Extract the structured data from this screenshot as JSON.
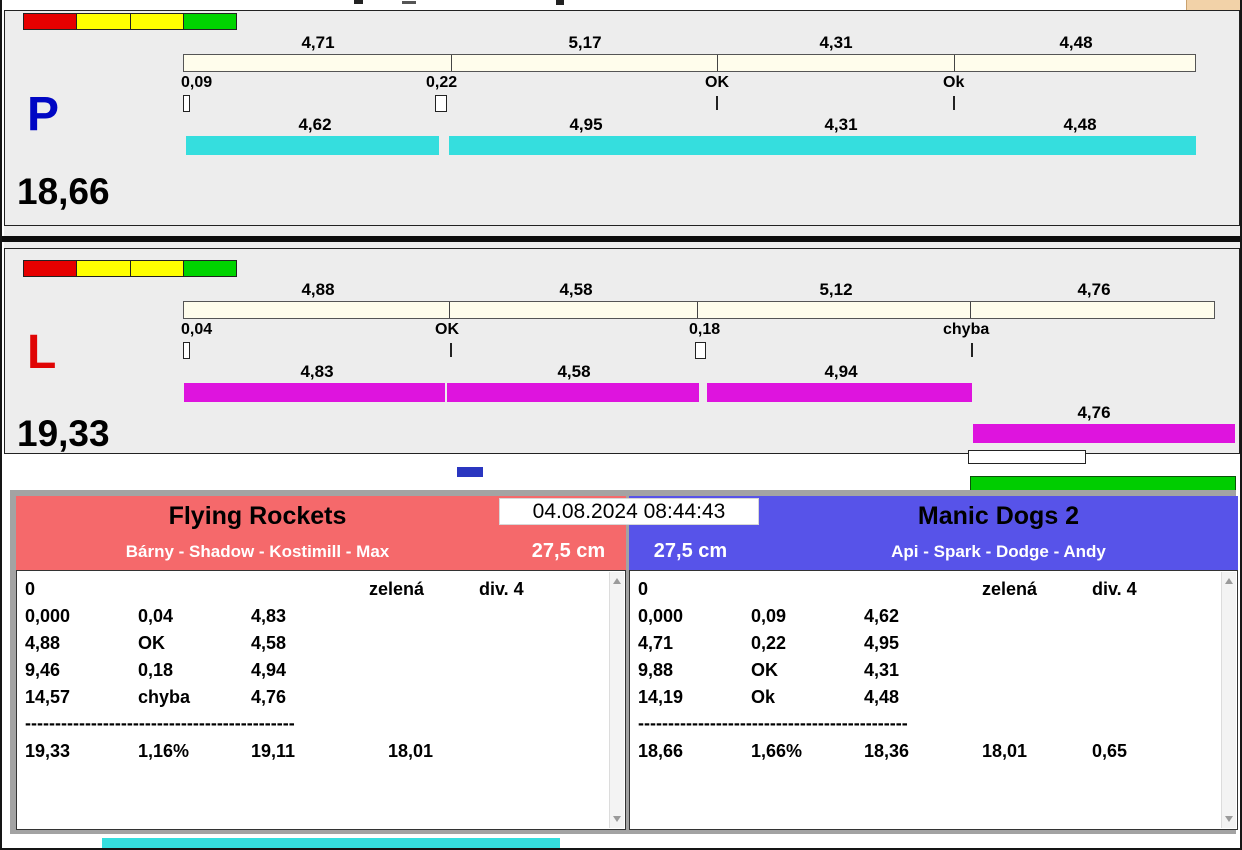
{
  "window": {
    "datetime": "04.08.2024 08:44:43"
  },
  "lanes": {
    "p": {
      "letter": "P",
      "total": "18,66",
      "splits_top": [
        "4,71",
        "5,17",
        "4,31",
        "4,48"
      ],
      "change_labels": [
        "0,09",
        "0,22",
        "OK",
        "Ok"
      ],
      "splits_bottom": [
        "4,62",
        "4,95",
        "4,31",
        "4,48"
      ]
    },
    "l": {
      "letter": "L",
      "total": "19,33",
      "splits_top": [
        "4,88",
        "4,58",
        "5,12",
        "4,76"
      ],
      "change_labels": [
        "0,04",
        "OK",
        "0,18",
        "chyba"
      ],
      "splits_bottom": [
        "4,83",
        "4,58",
        "4,94"
      ],
      "split_extra": "4,76"
    }
  },
  "teams": {
    "left": {
      "name": "Flying Rockets",
      "members": "Bárny - Shadow - Kostimill - Max",
      "height": "27,5 cm",
      "log": {
        "header": [
          "0",
          "zelená",
          "div. 4"
        ],
        "rows": [
          [
            "0,000",
            "0,04",
            "4,83"
          ],
          [
            "4,88",
            "OK",
            "4,58"
          ],
          [
            "9,46",
            "0,18",
            "4,94"
          ],
          [
            "14,57",
            "chyba",
            "4,76"
          ]
        ],
        "separator": "---------------------------------------------",
        "summary": [
          "19,33",
          "1,16%",
          "19,11",
          "18,01"
        ]
      }
    },
    "right": {
      "name": "Manic Dogs 2",
      "members": "Api - Spark - Dodge - Andy",
      "height": "27,5 cm",
      "log": {
        "header": [
          "0",
          "zelená",
          "div. 4"
        ],
        "rows": [
          [
            "0,000",
            "0,09",
            "4,62"
          ],
          [
            "4,71",
            "0,22",
            "4,95"
          ],
          [
            "9,88",
            "OK",
            "4,31"
          ],
          [
            "14,19",
            "Ok",
            "4,48"
          ]
        ],
        "separator": "---------------------------------------------",
        "summary": [
          "18,66",
          "1,66%",
          "18,36",
          "18,01",
          "0,65"
        ]
      }
    }
  },
  "colors": {
    "cyan_bar": "#35dede",
    "magenta_bar": "#de14de",
    "cream_bar": "#fffdec",
    "green_bar": "#00cd00",
    "salmon_header": "#f5696b",
    "blue_header": "#5753e9",
    "p_letter": "#0007c4",
    "l_letter": "#e00505",
    "indicator_red": "#e60000",
    "indicator_yellow": "#ffff00",
    "indicator_green": "#00d400",
    "accent_dash": "#2a36c0"
  }
}
